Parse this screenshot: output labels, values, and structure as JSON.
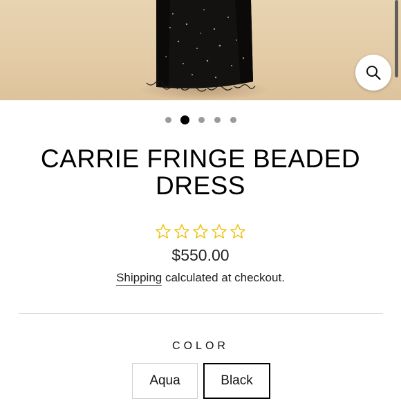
{
  "gallery": {
    "slide_count": 5,
    "active_slide": 2
  },
  "icons": {
    "zoom": "search-icon",
    "rating": "star-outline-icon"
  },
  "product": {
    "title_line1": "CARRIE FRINGE BEADED",
    "title_line2": "DRESS",
    "rating": 0,
    "rating_max": 5,
    "price": "$550.00"
  },
  "shipping": {
    "link_label": "Shipping",
    "text": " calculated at checkout."
  },
  "options": {
    "color_label": "COLOR",
    "colors": [
      "Aqua",
      "Black"
    ],
    "selected": "Black"
  },
  "colors": {
    "star": "#f0c419",
    "selected_border": "#000000",
    "photo_background": "#e3cba6"
  }
}
